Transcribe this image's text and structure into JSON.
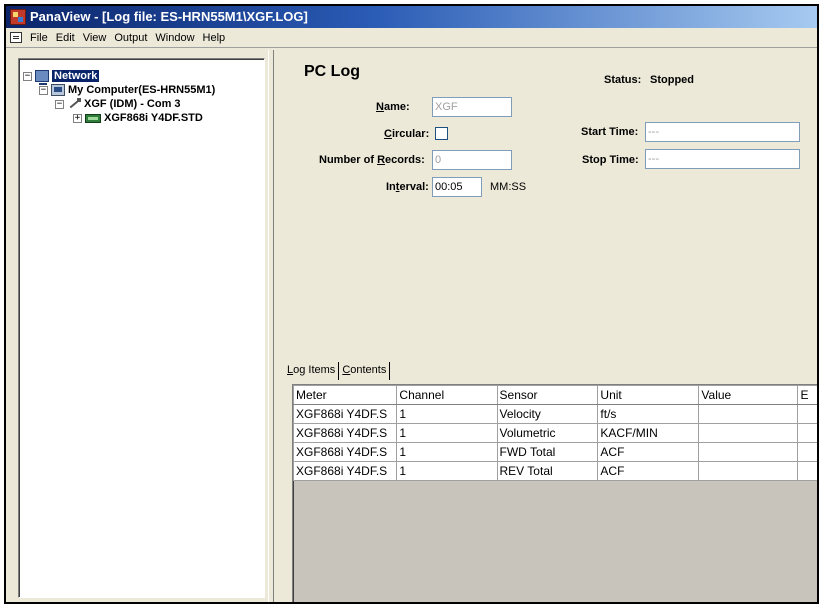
{
  "window": {
    "title": "PanaView - [Log file: ES-HRN55M1\\XGF.LOG]"
  },
  "menu": [
    "File",
    "Edit",
    "View",
    "Output",
    "Window",
    "Help"
  ],
  "tree": {
    "network": "Network",
    "computer": "My Computer(ES-HRN55M1)",
    "com": "XGF (IDM) - Com 3",
    "meter": "XGF868i Y4DF.STD"
  },
  "pc_log": {
    "title": "PC Log",
    "status_label": "Status:",
    "status_value": "Stopped",
    "name_label": "Name:",
    "name_value": "XGF",
    "circular_label": "Circular:",
    "records_label": "Number of Records:",
    "records_value": "0",
    "interval_label": "Interval:",
    "interval_value": "00:05",
    "interval_units": "MM:SS",
    "start_time_label": "Start Time:",
    "start_time_value": "---",
    "stop_time_label": "Stop Time:",
    "stop_time_value": "---"
  },
  "tabs": [
    "Log Items",
    "Contents"
  ],
  "grid": {
    "columns": [
      "Meter",
      "Channel",
      "Sensor",
      "Unit",
      "Value",
      "E"
    ],
    "rows": [
      [
        "XGF868i Y4DF.S",
        "1",
        "Velocity",
        "ft/s",
        "",
        ""
      ],
      [
        "XGF868i Y4DF.S",
        "1",
        "Volumetric",
        "KACF/MIN",
        "",
        ""
      ],
      [
        "XGF868i Y4DF.S",
        "1",
        "FWD Total",
        "ACF",
        "",
        ""
      ],
      [
        "XGF868i Y4DF.S",
        "1",
        "REV Total",
        "ACF",
        "",
        ""
      ]
    ]
  }
}
